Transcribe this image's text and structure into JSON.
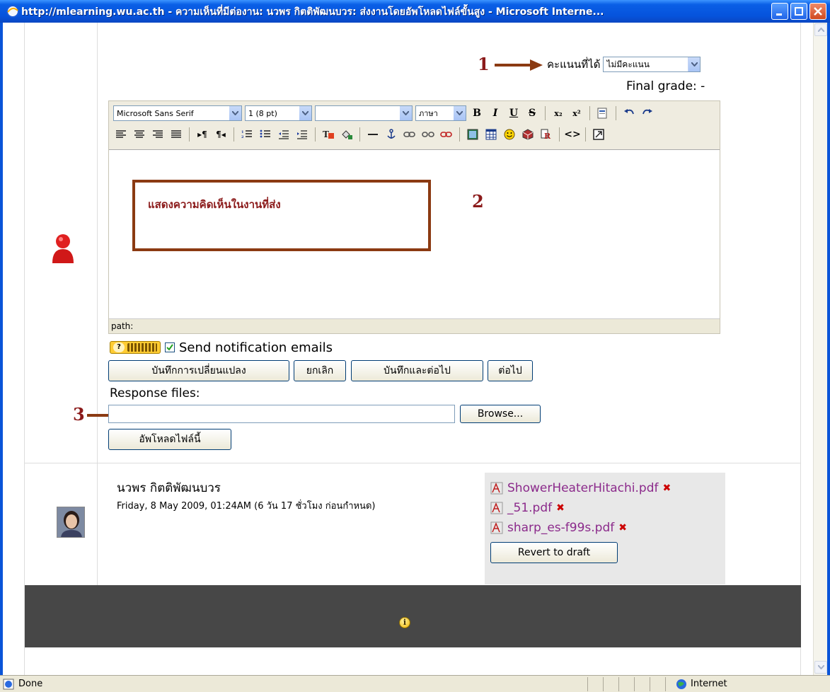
{
  "window": {
    "title": "http://mlearning.wu.ac.th - ความเห็นที่มีต่องาน: นวพร กิตติพัฒนบวร: ส่งงานโดยอัพโหลดไฟล์ขั้นสูง - Microsoft Interne..."
  },
  "grading": {
    "score_label": "คะแนนที่ได้",
    "score_value": "ไม่มีคะแนน",
    "final_grade": "Final grade: -"
  },
  "editor": {
    "font_family": "Microsoft Sans Serif",
    "font_size": "1 (8 pt)",
    "heading_value": "",
    "language": "ภาษา",
    "path_label": "path:",
    "annotation_text": "แสดงความคิดเห็นในงานที่ส่ง"
  },
  "annotations": {
    "num1": "1",
    "num2": "2",
    "num3": "3",
    "color": "#8b1a1a"
  },
  "notify": {
    "label": "Send notification emails",
    "checked": true
  },
  "actions": {
    "save_changes": "บันทึกการเปลี่ยนแปลง",
    "cancel": "ยกเลิก",
    "save_next": "บันทึกและต่อไป",
    "next": "ต่อไป"
  },
  "response": {
    "label": "Response files:",
    "file_value": "",
    "browse": "Browse...",
    "upload": "อัพโหลดไฟล์นี้"
  },
  "submission": {
    "name": "นวพร กิตติพัฒนบวร",
    "date": "Friday, 8 May 2009, 01:24AM (6 วัน 17 ชั่วโมง ก่อนกำหนด)",
    "files": [
      {
        "name": "ShowerHeaterHitachi.pdf"
      },
      {
        "name": "_51.pdf"
      },
      {
        "name": "sharp_es-f99s.pdf"
      }
    ],
    "revert": "Revert to draft"
  },
  "statusbar": {
    "left": "Done",
    "zone": "Internet"
  }
}
